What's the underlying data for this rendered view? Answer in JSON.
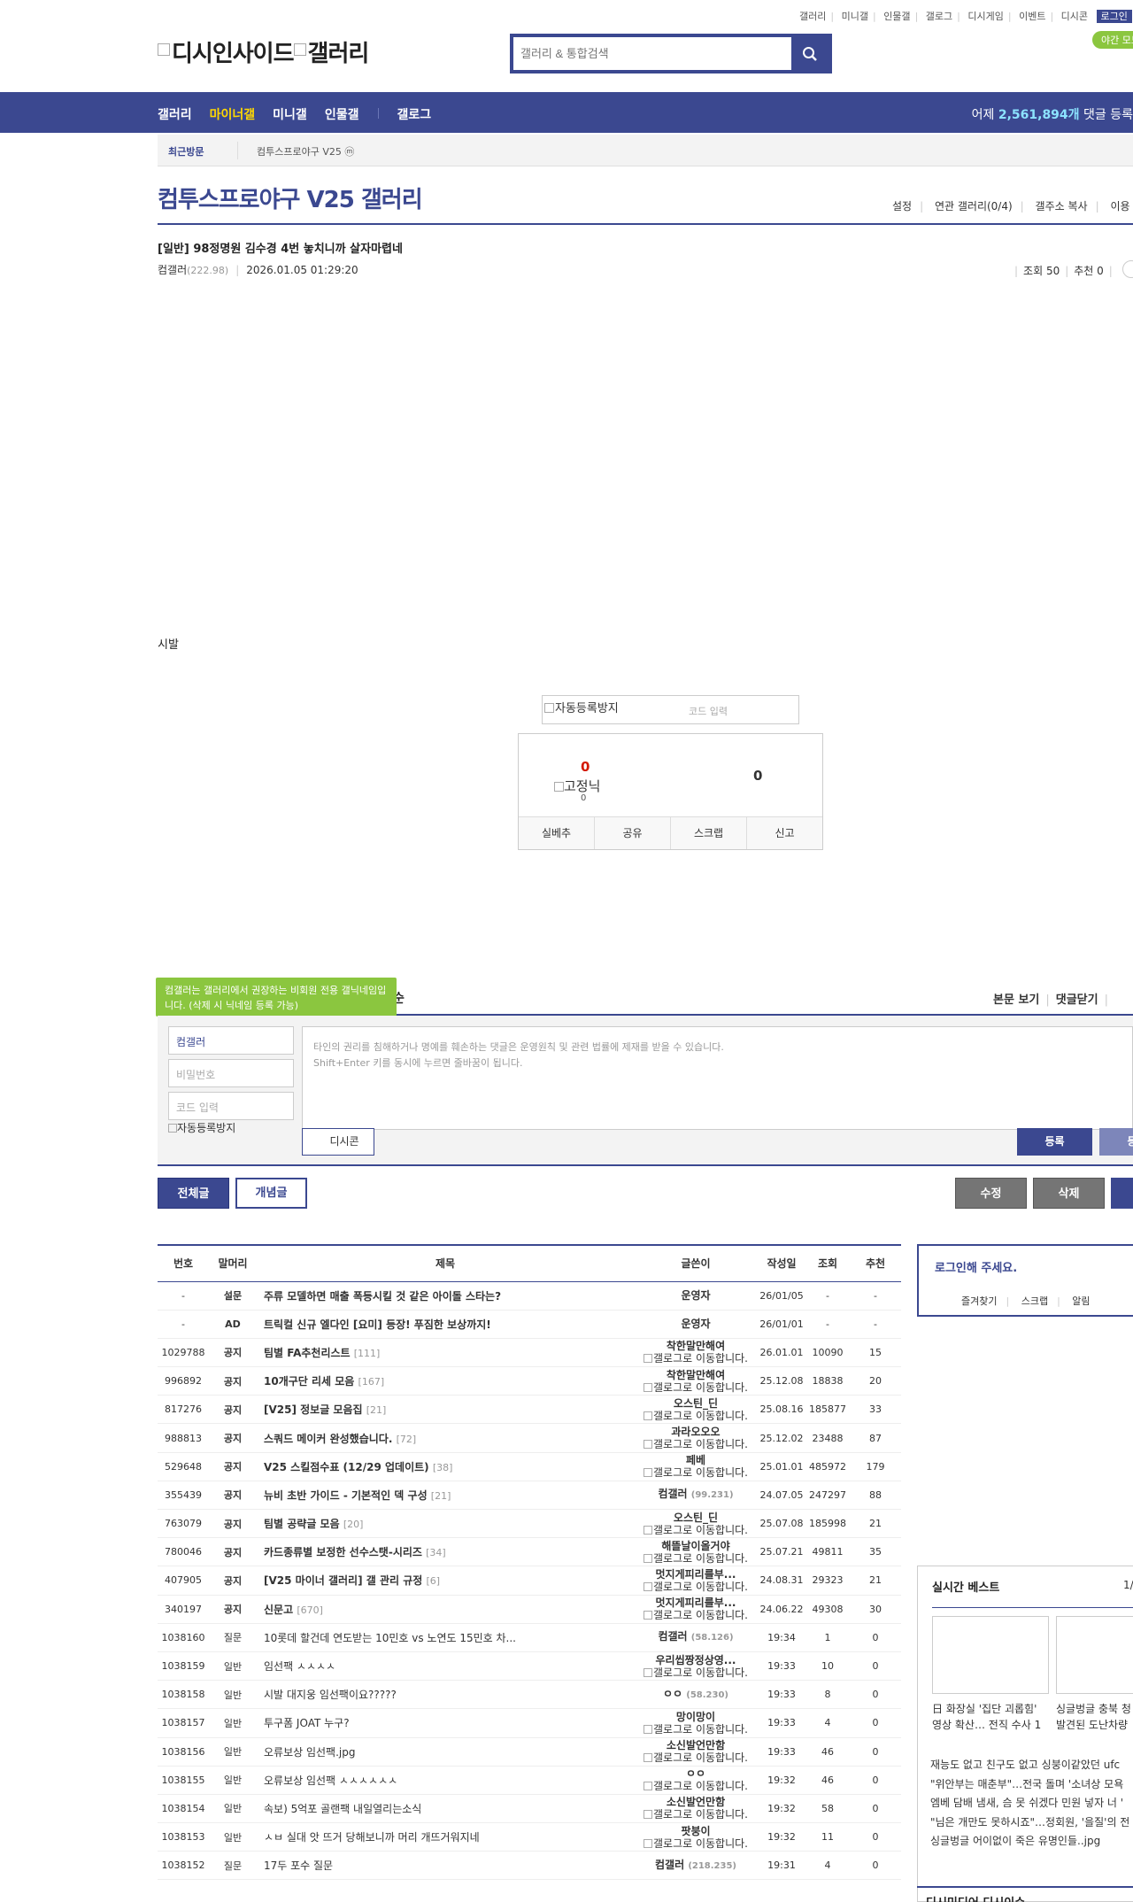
{
  "util": {
    "links": [
      "갤러리",
      "미니갤",
      "인물갤",
      "갤로그",
      "디시게임",
      "이벤트",
      "디시콘"
    ],
    "login": "로그인",
    "night": "야간 모드"
  },
  "logo": {
    "text1": "디시인사이드",
    "text2": "갤러리"
  },
  "search": {
    "placeholder": "갤러리 & 통합검색"
  },
  "gnb": {
    "items": [
      "갤러리",
      "마이너갤",
      "미니갤",
      "인물갤",
      "갤로그"
    ],
    "active": "마이너갤",
    "stat_prefix": "어제",
    "stat_count": "2,561,894개",
    "stat_suffix": "댓글 등록"
  },
  "recent": {
    "title": "최근방문",
    "item": "컴투스프로야구 V25 ⓜ"
  },
  "gallery": {
    "title": "컴투스프로야구 V25 갤러리",
    "menu": [
      "설정",
      "연관 갤러리(0/4)",
      "갤주소 복사",
      "이용"
    ]
  },
  "post": {
    "title": "[일반] 98정명원 김수경 4번 놓치니까 살자마렵네",
    "author": "컴갤러",
    "author_ip": "(222.98)",
    "date": "2026.01.05 01:29:20",
    "views": "조회 50",
    "recommends": "추천 0",
    "body": "시발"
  },
  "captcha": {
    "img_alt": "자동등록방지",
    "placeholder": "코드 입력"
  },
  "recommend": {
    "up": "0",
    "fix_alt": "고정닉",
    "fix_count": "0",
    "down": "0",
    "buttons": [
      "실베추",
      "공유",
      "스크랩",
      "신고"
    ]
  },
  "comment": {
    "tooltip": "컴갤러는 갤러리에서 권장하는 비회원 전용 갤닉네임입니다. (삭제 시 닉네임 등록 가능)",
    "header_tail": "순",
    "links": [
      "본문 보기",
      "댓글닫기"
    ],
    "name_value": "컴갤러",
    "password_placeholder": "비밀번호",
    "code_placeholder": "코드 입력",
    "captcha_alt": "자동등록방지",
    "text_line1": "타인의 권리를 침해하거나 명예를 훼손하는 댓글은 운영원칙 및 관련 법률에 제재를 받을 수 있습니다.",
    "text_line2": "Shift+Enter 키를 동시에 누르면 줄바꿈이 됩니다.",
    "dccon": "디시콘",
    "submit": "등록",
    "submit2": "등록"
  },
  "list_buttons": {
    "all": "전체글",
    "concept": "개념글",
    "edit": "수정",
    "delete": "삭제"
  },
  "table": {
    "headers": [
      "번호",
      "말머리",
      "제목",
      "글쓴이",
      "작성일",
      "조회",
      "추천"
    ],
    "rows": [
      {
        "no": "-",
        "head": "설문",
        "subject": "주류 모델하면 매출 폭등시킬 것 같은 아이돌 스타는?",
        "rc": "",
        "writer": "운영자",
        "ip": "",
        "img": false,
        "date": "26/01/05",
        "views": "-",
        "rec": "-",
        "bold": true
      },
      {
        "no": "-",
        "head": "AD",
        "subject": "트릭컬 신규 엘다인 [요미] 등장! 푸짐한 보상까지!",
        "rc": "",
        "writer": "운영자",
        "ip": "",
        "img": false,
        "date": "26/01/01",
        "views": "-",
        "rec": "-",
        "bold": true
      },
      {
        "no": "1029788",
        "head": "공지",
        "subject": "팀별 FA추천리스트",
        "rc": "[111]",
        "writer": "착한말만해여",
        "ip": "",
        "img": true,
        "date": "26.01.01",
        "views": "10090",
        "rec": "15",
        "bold": true
      },
      {
        "no": "996892",
        "head": "공지",
        "subject": "10개구단 리세 모음",
        "rc": "[167]",
        "writer": "착한말만해여",
        "ip": "",
        "img": true,
        "date": "25.12.08",
        "views": "18838",
        "rec": "20",
        "bold": true
      },
      {
        "no": "817276",
        "head": "공지",
        "subject": "[V25] 정보글 모음집",
        "rc": "[21]",
        "writer": "오스틴_딘",
        "ip": "",
        "img": true,
        "date": "25.08.16",
        "views": "185877",
        "rec": "33",
        "bold": true
      },
      {
        "no": "988813",
        "head": "공지",
        "subject": "스쿼드 메이커 완성했습니다.",
        "rc": "[72]",
        "writer": "과라오오오",
        "ip": "",
        "img": true,
        "date": "25.12.02",
        "views": "23488",
        "rec": "87",
        "bold": true
      },
      {
        "no": "529648",
        "head": "공지",
        "subject": "V25 스킬점수표 (12/29 업데이트)",
        "rc": "[38]",
        "writer": "페베",
        "ip": "",
        "img": true,
        "date": "25.01.01",
        "views": "485972",
        "rec": "179",
        "bold": true
      },
      {
        "no": "355439",
        "head": "공지",
        "subject": "뉴비 초반 가이드 - 기본적인 덱 구성",
        "rc": "[21]",
        "writer": "컴갤러",
        "ip": "(99.231)",
        "img": false,
        "date": "24.07.05",
        "views": "247297",
        "rec": "88",
        "bold": true
      },
      {
        "no": "763079",
        "head": "공지",
        "subject": "팀별 공략글 모음",
        "rc": "[20]",
        "writer": "오스틴_딘",
        "ip": "",
        "img": true,
        "date": "25.07.08",
        "views": "185998",
        "rec": "21",
        "bold": true
      },
      {
        "no": "780046",
        "head": "공지",
        "subject": "카드종류별 보정한 선수스탯-시리즈",
        "rc": "[34]",
        "writer": "해뜰날이올거야",
        "ip": "",
        "img": true,
        "date": "25.07.21",
        "views": "49811",
        "rec": "35",
        "bold": true
      },
      {
        "no": "407905",
        "head": "공지",
        "subject": "[V25 마이너 갤러리] 갤 관리 규정",
        "rc": "[6]",
        "writer": "멋지게피리를부...",
        "ip": "",
        "img": true,
        "date": "24.08.31",
        "views": "29323",
        "rec": "21",
        "bold": true
      },
      {
        "no": "340197",
        "head": "공지",
        "subject": "신문고",
        "rc": "[670]",
        "writer": "멋지게피리를부...",
        "ip": "",
        "img": true,
        "date": "24.06.22",
        "views": "49308",
        "rec": "30",
        "bold": true
      },
      {
        "no": "1038160",
        "head": "질문",
        "subject": "10롯데 할건데 연도받는 10민호 vs 노연도 15민호 차...",
        "rc": "",
        "writer": "컴갤러",
        "ip": "(58.126)",
        "img": false,
        "date": "19:34",
        "views": "1",
        "rec": "0",
        "bold": false
      },
      {
        "no": "1038159",
        "head": "일반",
        "subject": "임선팩 ㅅㅅㅅㅅ",
        "rc": "",
        "writer": "우리씹짱정상영...",
        "ip": "",
        "img": true,
        "date": "19:33",
        "views": "10",
        "rec": "0",
        "bold": false
      },
      {
        "no": "1038158",
        "head": "일반",
        "subject": "시발 대지웅 임선팩이요?????",
        "rc": "",
        "writer": "ㅇㅇ",
        "ip": "(58.230)",
        "img": false,
        "date": "19:33",
        "views": "8",
        "rec": "0",
        "bold": false
      },
      {
        "no": "1038157",
        "head": "일반",
        "subject": "투구폼 JOAT 누구?",
        "rc": "",
        "writer": "망이망이",
        "ip": "",
        "img": true,
        "date": "19:33",
        "views": "4",
        "rec": "0",
        "bold": false
      },
      {
        "no": "1038156",
        "head": "일반",
        "subject": "오류보상 임선팩.jpg",
        "rc": "",
        "writer": "소신발언만함",
        "ip": "",
        "img": true,
        "date": "19:33",
        "views": "46",
        "rec": "0",
        "bold": false
      },
      {
        "no": "1038155",
        "head": "일반",
        "subject": "오류보상 임선팩 ㅅㅅㅅㅅㅅㅅ",
        "rc": "",
        "writer": "ㅇㅇ",
        "ip": "",
        "img": true,
        "date": "19:32",
        "views": "46",
        "rec": "0",
        "bold": false
      },
      {
        "no": "1038154",
        "head": "일반",
        "subject": "속보) 5억포 골랜팩 내일열리는소식",
        "rc": "",
        "writer": "소신발언만함",
        "ip": "",
        "img": true,
        "date": "19:32",
        "views": "58",
        "rec": "0",
        "bold": false
      },
      {
        "no": "1038153",
        "head": "일반",
        "subject": "ㅅㅂ 실대 앗 뜨거 당해보니까 머리 개뜨거워지네",
        "rc": "",
        "writer": "팟붕이",
        "ip": "",
        "img": true,
        "date": "19:32",
        "views": "11",
        "rec": "0",
        "bold": false
      },
      {
        "no": "1038152",
        "head": "질문",
        "subject": "17두 포수 질문",
        "rc": "",
        "writer": "컴갤러",
        "ip": "(218.235)",
        "img": false,
        "date": "19:31",
        "views": "4",
        "rec": "0",
        "bold": false
      }
    ],
    "img_alt": "갤로그로 이동합니다."
  },
  "right": {
    "login_title": "로그인해 주세요.",
    "login_links": [
      "즐겨찾기",
      "스크랩",
      "알림"
    ],
    "best_title": "실시간 베스트",
    "best_page": "1/",
    "best_caps": [
      [
        "日 화장실 '집단 괴롭힘'",
        "영상 확산… 전직 수사 1"
      ],
      [
        "싱글벙글 충북 청",
        "발견된 도난차량"
      ]
    ],
    "best_list": [
      "재능도 없고 친구도 없고 싱붕이같았던 ufc",
      "\"위안부는 매춘부\"…전국 돌며 '소녀상 모욕",
      "엠베 담배 냄새, 슴 못 쉬겠다 민원 넣자 너 '",
      "\"님은 개만도 못하시죠\"…정회원, '을질'의 전",
      "싱글벙글 어이없이 죽은 유명인들..jpg"
    ],
    "dcmedia": "디시미디어 디시이슈"
  }
}
